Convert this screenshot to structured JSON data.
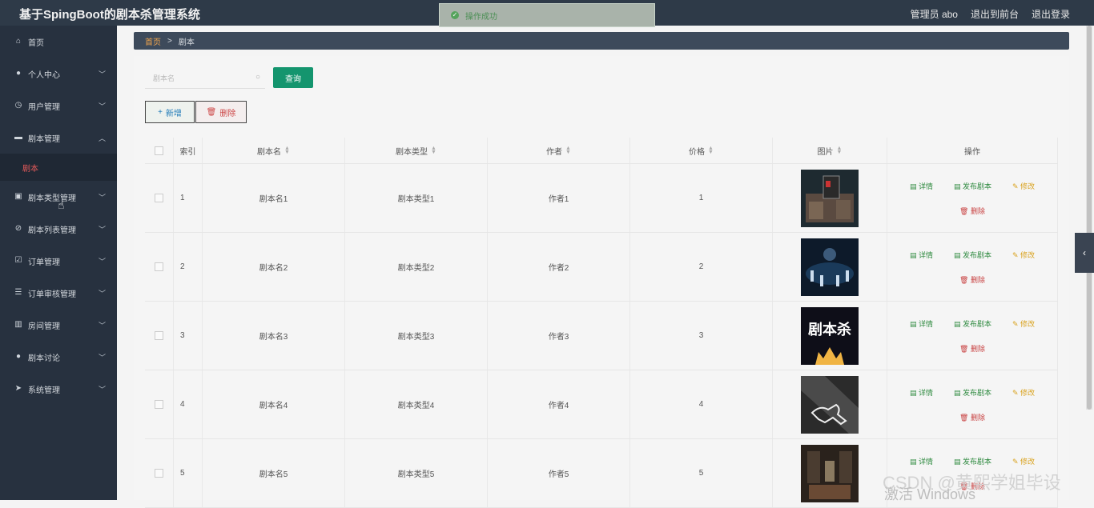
{
  "app": {
    "title": "基于SpingBoot的剧本杀管理系统",
    "top_right": [
      "管理员 abo",
      "退出到前台",
      "退出登录"
    ]
  },
  "toast": {
    "text": "操作成功"
  },
  "sidebar": {
    "items": [
      {
        "label": "首页",
        "icon": "home-icon",
        "chevron": false
      },
      {
        "label": "个人中心",
        "icon": "user-icon",
        "chevron": true
      },
      {
        "label": "用户管理",
        "icon": "clock-icon",
        "chevron": true
      },
      {
        "label": "剧本管理",
        "icon": "briefcase-icon",
        "chevron": "up"
      },
      {
        "label": "剧本类型管理",
        "icon": "clipboard-icon",
        "chevron": true
      },
      {
        "label": "剧本列表管理",
        "icon": "slash-circle-icon",
        "chevron": true
      },
      {
        "label": "订单管理",
        "icon": "checkbox-icon",
        "chevron": true
      },
      {
        "label": "订单审核管理",
        "icon": "list-icon",
        "chevron": true
      },
      {
        "label": "房间管理",
        "icon": "house-icon",
        "chevron": true
      },
      {
        "label": "剧本讨论",
        "icon": "person-icon",
        "chevron": true
      },
      {
        "label": "系统管理",
        "icon": "send-icon",
        "chevron": true
      }
    ],
    "submenu": {
      "label": "剧本"
    }
  },
  "breadcrumb": {
    "home": "首页",
    "sep": ">",
    "current": "剧本"
  },
  "search": {
    "placeholder": "剧本名",
    "query_label": "查询"
  },
  "actions": {
    "add_label": "新增",
    "delete_label": "删除"
  },
  "table": {
    "headers": [
      "",
      "索引",
      "剧本名",
      "剧本类型",
      "作者",
      "价格",
      "图片",
      "操作"
    ],
    "rows": [
      {
        "index": "1",
        "name": "剧本名1",
        "type": "剧本类型1",
        "author": "作者1",
        "price": "1"
      },
      {
        "index": "2",
        "name": "剧本名2",
        "type": "剧本类型2",
        "author": "作者2",
        "price": "2"
      },
      {
        "index": "3",
        "name": "剧本名3",
        "type": "剧本类型3",
        "author": "作者3",
        "price": "3",
        "image_text": "剧本杀"
      },
      {
        "index": "4",
        "name": "剧本名4",
        "type": "剧本类型4",
        "author": "作者4",
        "price": "4"
      },
      {
        "index": "5",
        "name": "剧本名5",
        "type": "剧本类型5",
        "author": "作者5",
        "price": "5"
      }
    ],
    "ops": {
      "detail": "详情",
      "publish": "发布剧本",
      "edit": "修改",
      "delete": "删除"
    }
  },
  "watermark": {
    "csdn": "CSDN @黄熙学姐毕设",
    "windows": "激活 Windows"
  }
}
